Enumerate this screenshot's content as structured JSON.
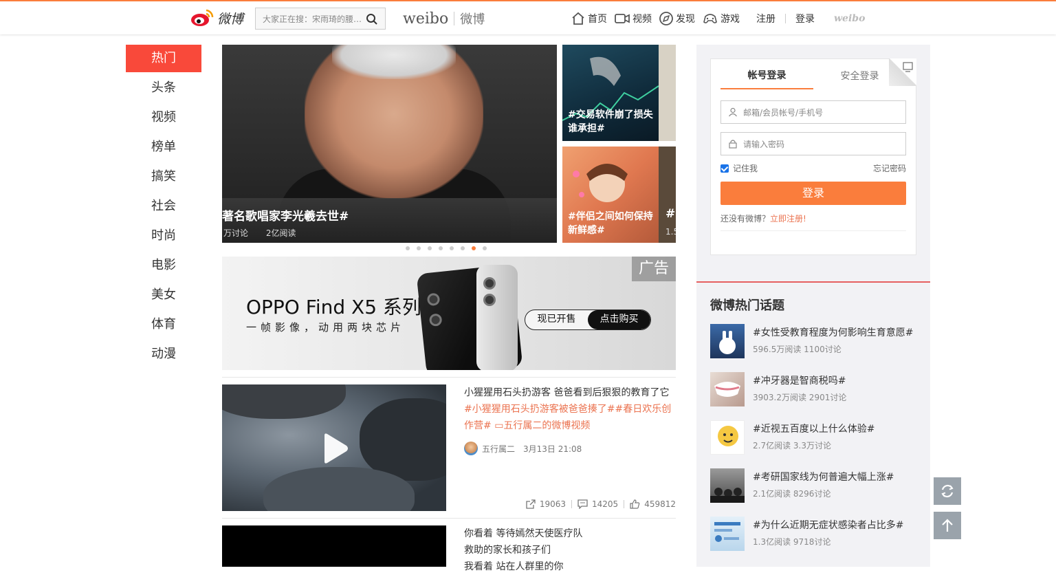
{
  "header": {
    "logo_text": "微博",
    "search_placeholder": "大家正在搜：宋雨琦的腰…",
    "brand_en": "weibo",
    "brand_cn": "微博",
    "nav": [
      {
        "label": "首页",
        "icon": "home-icon"
      },
      {
        "label": "视频",
        "icon": "video-icon"
      },
      {
        "label": "发现",
        "icon": "compass-icon"
      },
      {
        "label": "游戏",
        "icon": "gamepad-icon"
      }
    ],
    "register": "注册",
    "login": "登录",
    "small_logo": "weibo"
  },
  "sidebar": {
    "items": [
      "热门",
      "头条",
      "视频",
      "榜单",
      "搞笑",
      "社会",
      "时尚",
      "电影",
      "美女",
      "体育",
      "动漫"
    ]
  },
  "carousel": {
    "main_title": "著名歌唱家李光羲去世#",
    "main_discuss": "万讨论",
    "main_read": "2亿阅读",
    "side1_title": "#交易软件崩了损失谁承担#",
    "side2_title": "#伴侣之间如何保持新鲜感#",
    "peek_text": "#",
    "peek_num": "1.5",
    "active_dot": 6,
    "dot_count": 8
  },
  "ad": {
    "title": "OPPO Find X5 系列",
    "subtitle": "一帧影像，动用两块芯片",
    "btn_a": "现已开售",
    "btn_b": "点击购买",
    "badge": "广告"
  },
  "posts": [
    {
      "text": "小猩猩用石头扔游客 爸爸看到后狠狠的教育了它",
      "tags": "#小猩猩用石头扔游客被爸爸揍了##春日欢乐创作营# ",
      "video_link": "五行属二的微博视频",
      "author": "五行属二",
      "time": "3月13日 21:08",
      "shares": "19063",
      "comments": "14205",
      "likes": "459812"
    },
    {
      "line1": "你看着 等待嫣然天使医疗队",
      "line2": "救助的家长和孩子们",
      "line3": "我看着 站在人群里的你"
    }
  ],
  "login": {
    "tab_account": "帐号登录",
    "tab_secure": "安全登录",
    "user_placeholder": "邮箱/会员帐号/手机号",
    "pass_placeholder": "请输入密码",
    "remember": "记住我",
    "forgot": "忘记密码",
    "button": "登录",
    "no_account": "还没有微博？",
    "register_now": "立即注册!"
  },
  "topics": {
    "title": "微博热门话题",
    "items": [
      {
        "name": "#女性受教育程度为何影响生育意愿#",
        "stats": "596.5万阅读 1100讨论",
        "color": "#2c4b7a"
      },
      {
        "name": "#冲牙器是智商税吗#",
        "stats": "3903.2万阅读 2901讨论",
        "color": "#c9b8b0"
      },
      {
        "name": "#近视五百度以上什么体验#",
        "stats": "2.7亿阅读 3.3万讨论",
        "color": "#f5c842"
      },
      {
        "name": "#考研国家线为何普遍大幅上涨#",
        "stats": "2.1亿阅读 8296讨论",
        "color": "#6a6a6a"
      },
      {
        "name": "#为什么近期无症状感染者占比多#",
        "stats": "1.3亿阅读 9718讨论",
        "color": "#cfe3f2"
      }
    ]
  },
  "colors": {
    "accent": "#fa7d3c",
    "active_nav": "#f9493a",
    "link": "#eb7350"
  }
}
